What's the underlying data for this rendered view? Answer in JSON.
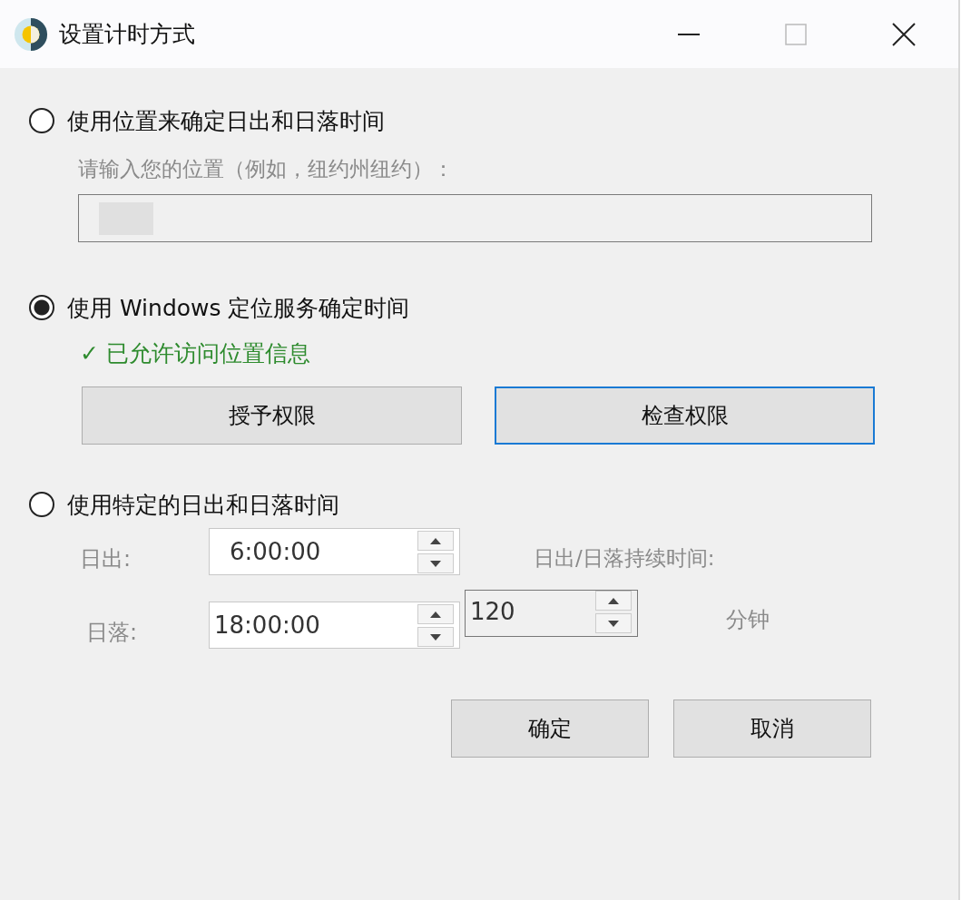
{
  "window": {
    "title": "设置计时方式"
  },
  "options": [
    {
      "label": "使用位置来确定日出和日落时间",
      "selected": false,
      "kind": "location",
      "disabled": true,
      "hint": "请输入您的位置（例如，纽约州纽约）："
    },
    {
      "label": "使用 Windows 定位服务确定时间",
      "selected": true,
      "kind": "service",
      "status": "✓ 已允许访问位置信息",
      "buttons": [
        {
          "label": "授予权限",
          "focused": false
        },
        {
          "label": "检查权限",
          "focused": true
        }
      ]
    },
    {
      "label": "使用特定的日出和日落时间",
      "selected": false,
      "kind": "times",
      "disabled": true,
      "sunrise_label": "日出:",
      "sunrise": "6:00:00",
      "sunset_label": "日落:",
      "sunset": "18:00:00",
      "duration_label": "日出/日落持续时间:",
      "duration": "120",
      "duration_unit": "分钟"
    }
  ],
  "buttons": [
    "确定",
    "取消"
  ]
}
